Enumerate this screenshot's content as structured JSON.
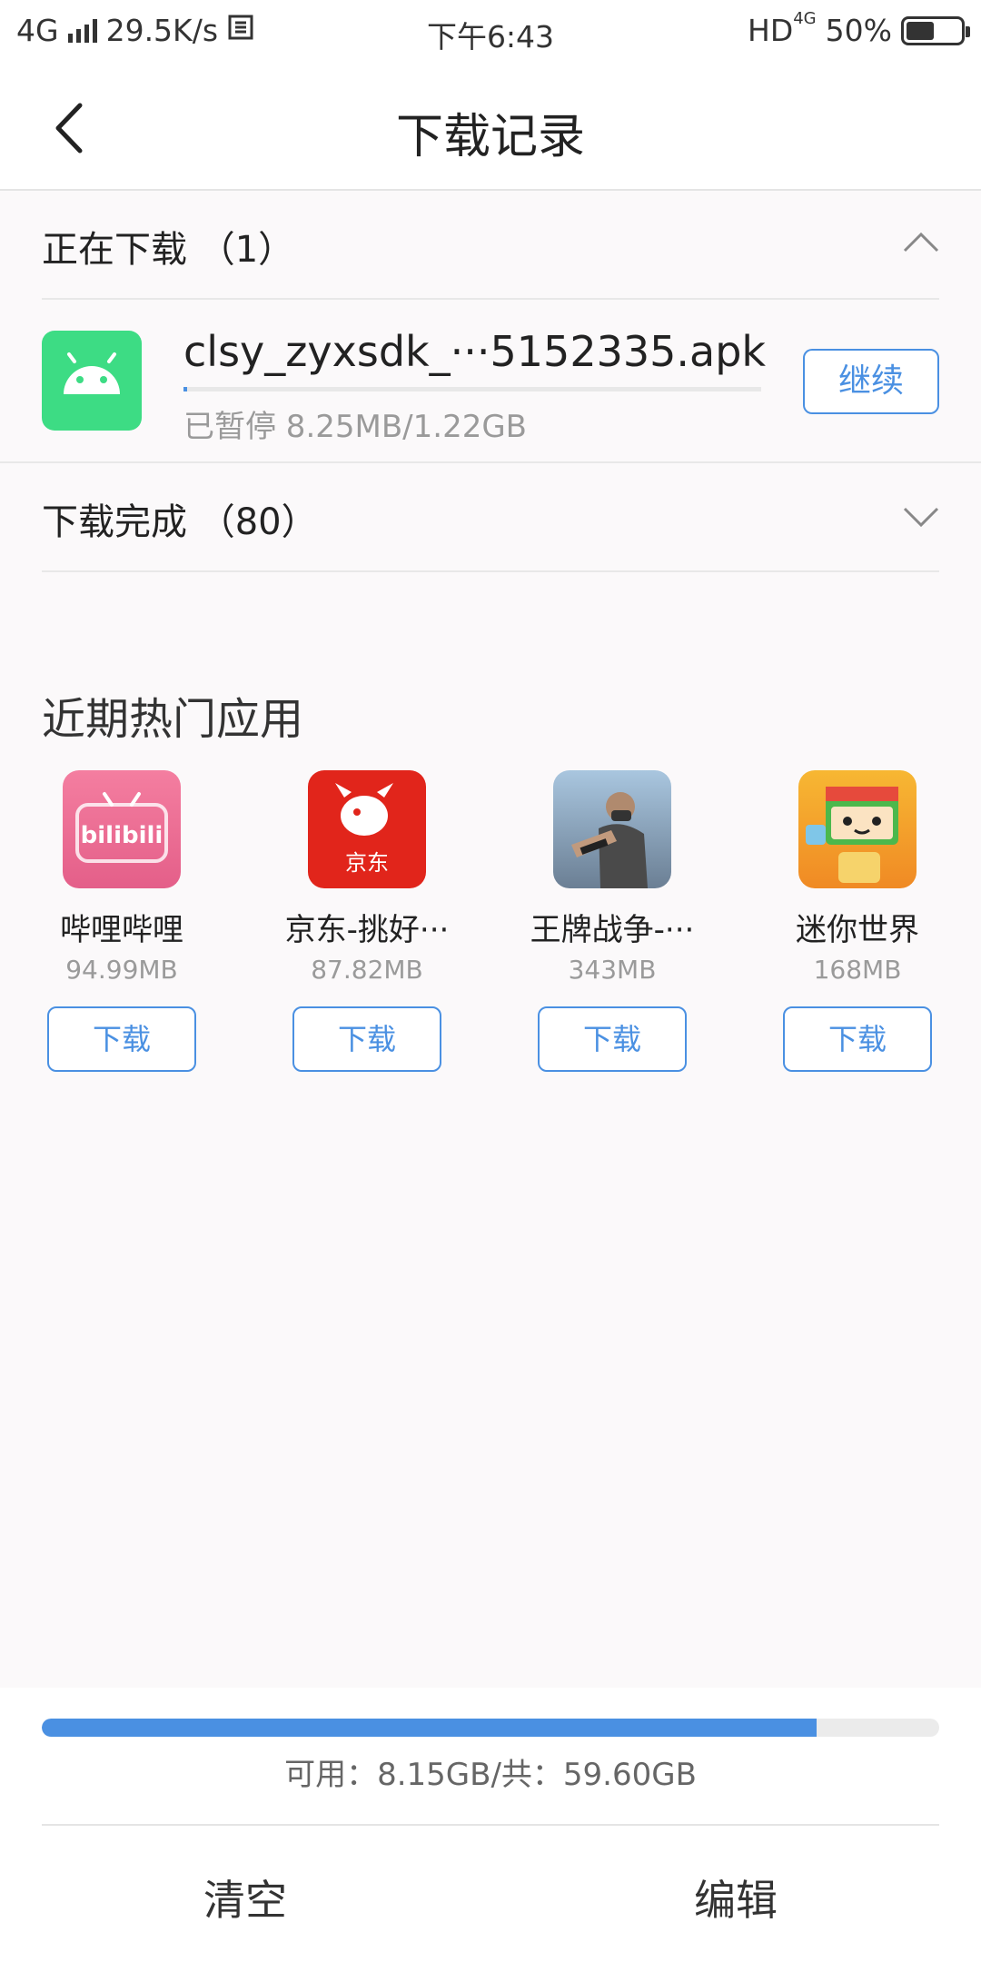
{
  "status_bar": {
    "network": "4G",
    "speed": "29.5K/s",
    "time": "下午6:43",
    "hd": "HD",
    "hd_network": "4G",
    "battery": "50%",
    "battery_level": 0.5
  },
  "header": {
    "title": "下载记录"
  },
  "downloading": {
    "label": "正在下载 （1）",
    "item": {
      "name": "clsy_zyxsdk_···5152335.apk",
      "status": "已暂停 8.25MB/1.22GB",
      "progress": 0.0066,
      "button": "继续",
      "icon_color": "#3ddc84",
      "icon": "android-icon"
    }
  },
  "completed": {
    "label": "下载完成 （80）"
  },
  "hot_apps": {
    "title": "近期热门应用",
    "items": [
      {
        "name": "哔哩哔哩",
        "size": "94.99MB",
        "button": "下载",
        "icon": "bilibili-icon",
        "icon_text": "bilibili"
      },
      {
        "name": "京东-挑好···",
        "size": "87.82MB",
        "button": "下载",
        "icon": "jd-icon",
        "icon_text": "京东"
      },
      {
        "name": "王牌战争-···",
        "size": "343MB",
        "button": "下载",
        "icon": "game-soldier-icon"
      },
      {
        "name": "迷你世界",
        "size": "168MB",
        "button": "下载",
        "icon": "mini-world-icon"
      }
    ]
  },
  "storage": {
    "text": "可用：8.15GB/共：59.60GB",
    "used_fraction": 0.8633,
    "bar_color": "#4a90e2"
  },
  "actions": {
    "clear": "清空",
    "edit": "编辑"
  }
}
